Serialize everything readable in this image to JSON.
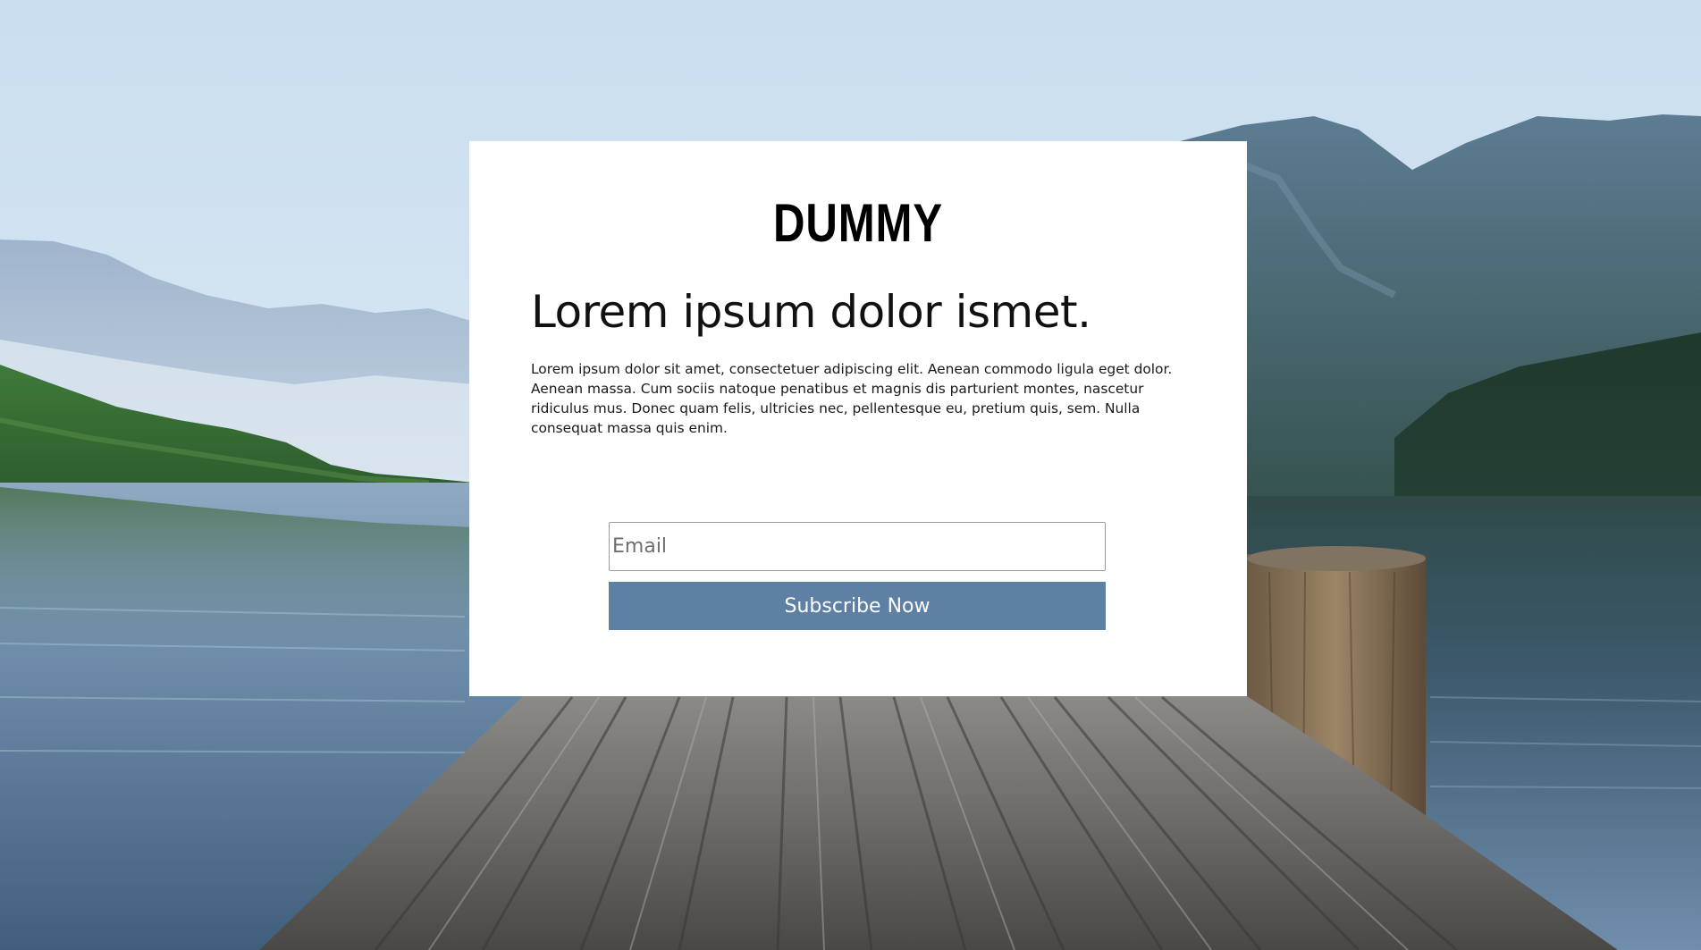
{
  "background": {
    "description_icon": "lake-pier-photo"
  },
  "card": {
    "brand": "DUMMY",
    "headline": "Lorem ipsum dolor ismet.",
    "body": "Lorem ipsum dolor sit amet, consectetuer adipiscing elit. Aenean commodo ligula eget dolor. Aenean massa. Cum sociis natoque penatibus et magnis dis parturient montes, nascetur ridiculus mus. Donec quam felis, ultricies nec, pellentesque eu, pretium quis, sem. Nulla consequat massa quis enim.",
    "email": {
      "value": "",
      "placeholder": "Email"
    },
    "subscribe_label": "Subscribe Now"
  },
  "colors": {
    "button": "#5e80a5",
    "card": "#ffffff"
  }
}
